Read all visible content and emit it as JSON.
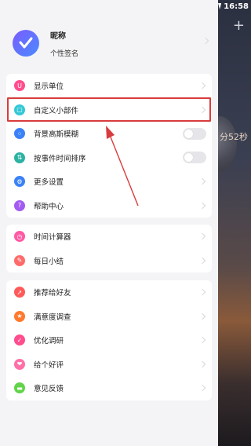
{
  "status": {
    "time": "16:58"
  },
  "backdrop": {
    "plus": "+",
    "timer_fragment": "分52秒"
  },
  "profile": {
    "nickname": "昵称",
    "signature": "个性签名"
  },
  "group1": [
    {
      "label": "显示单位",
      "icon": "unit-icon",
      "color": "#ff4d8d",
      "control": "chevron"
    },
    {
      "label": "自定义小部件",
      "icon": "widget-icon",
      "color": "#33c8d6",
      "control": "chevron"
    },
    {
      "label": "背景高斯模糊",
      "icon": "blur-icon",
      "color": "#3b82f6",
      "control": "toggle",
      "on": false
    },
    {
      "label": "按事件时间排序",
      "icon": "sort-icon",
      "color": "#2bb3a3",
      "control": "toggle",
      "on": false
    },
    {
      "label": "更多设置",
      "icon": "gear-icon",
      "color": "#3b82f6",
      "control": "chevron"
    },
    {
      "label": "帮助中心",
      "icon": "help-icon",
      "color": "#a35cf0",
      "control": "chevron"
    }
  ],
  "group2": [
    {
      "label": "时间计算器",
      "icon": "clock-icon",
      "color": "#ff5aa5",
      "control": "chevron"
    },
    {
      "label": "每日小结",
      "icon": "summary-icon",
      "color": "#ff6b6b",
      "control": "chevron"
    }
  ],
  "group3": [
    {
      "label": "推荐给好友",
      "icon": "share-icon",
      "color": "#ff5a5a",
      "control": "chevron"
    },
    {
      "label": "满意度调查",
      "icon": "star-icon",
      "color": "#ff7a2e",
      "control": "chevron"
    },
    {
      "label": "优化调研",
      "icon": "check-icon",
      "color": "#ff4d8d",
      "control": "chevron"
    },
    {
      "label": "给个好评",
      "icon": "heart-icon",
      "color": "#ff6fa8",
      "control": "chevron"
    },
    {
      "label": "意见反馈",
      "icon": "feedback-icon",
      "color": "#62d34a",
      "control": "chevron"
    }
  ],
  "annotation": {
    "highlight_color": "#d93c3c"
  }
}
